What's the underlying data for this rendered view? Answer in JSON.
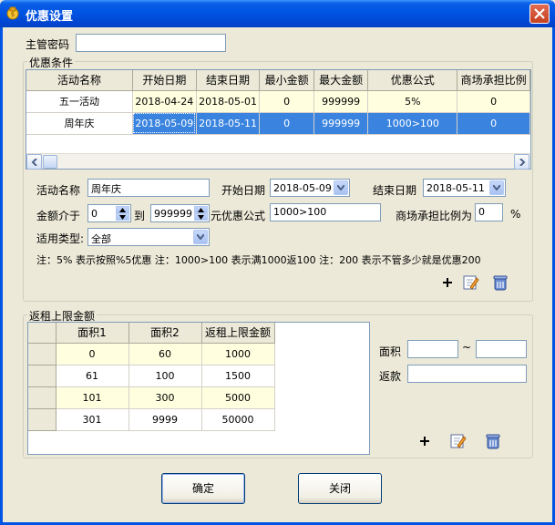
{
  "window": {
    "title": "优惠设置"
  },
  "supervisor": {
    "label": "主管密码",
    "value": ""
  },
  "promo": {
    "legend": "优惠条件",
    "columns": [
      "活动名称",
      "开始日期",
      "结束日期",
      "最小金额",
      "最大金额",
      "优惠公式",
      "商场承担比例"
    ],
    "rows": [
      [
        "五一活动",
        "2018-04-24",
        "2018-05-01",
        "0",
        "999999",
        "5%",
        "0"
      ],
      [
        "周年庆",
        "2018-05-09",
        "2018-05-11",
        "0",
        "999999",
        "1000>100",
        "0"
      ]
    ],
    "selected_row": 1
  },
  "form": {
    "name_label": "活动名称",
    "name_value": "周年庆",
    "start_label": "开始日期",
    "start_value": "2018-05-09",
    "end_label": "结束日期",
    "end_value": "2018-05-11",
    "amount_label": "金额介于",
    "amount_min": "0",
    "to_label": "到",
    "amount_max": "999999",
    "formula_label": "元优惠公式",
    "formula_value": "1000>100",
    "ratio_label": "商场承担比例为",
    "ratio_value": "0",
    "percent": "%",
    "type_label": "适用类型:",
    "type_value": "全部",
    "note": "注：5% 表示按照%5优惠  注：1000>100 表示满1000返100   注：200 表示不管多少就是优惠200"
  },
  "rebate": {
    "legend": "返租上限金额",
    "columns": [
      "面积1",
      "面积2",
      "返租上限金额"
    ],
    "rows": [
      [
        "0",
        "60",
        "1000"
      ],
      [
        "61",
        "100",
        "1500"
      ],
      [
        "101",
        "300",
        "5000"
      ],
      [
        "301",
        "9999",
        "50000"
      ]
    ],
    "area_label": "面积",
    "tilde": "~",
    "area_from": "",
    "area_to": "",
    "amount_label": "返款",
    "amount_value": ""
  },
  "buttons": {
    "ok": "确定",
    "close": "关闭"
  },
  "icons": {
    "add": "plus-icon",
    "edit": "edit-pencil-icon",
    "delete": "delete-bin-icon"
  },
  "colors": {
    "titlebar": "#0054e3",
    "selected_row": "#3a84e0",
    "cream_row": "#ffffe0"
  }
}
